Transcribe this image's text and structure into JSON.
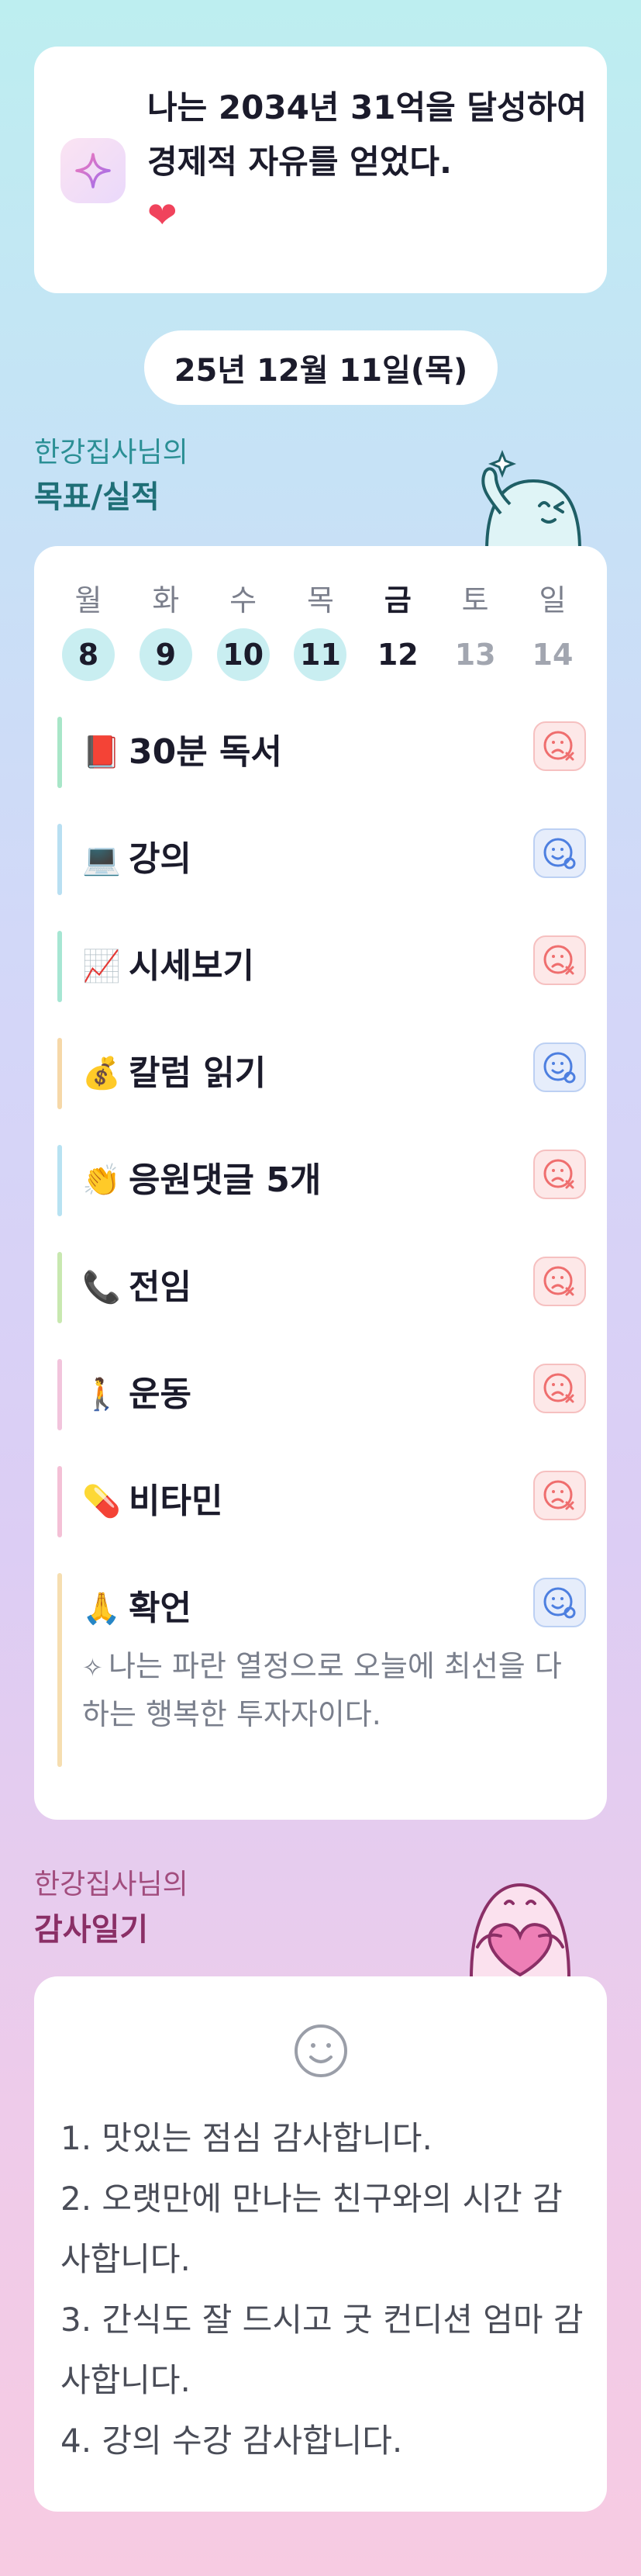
{
  "goal": {
    "text": "나는 2034년 31억을 달성하여 경제적 자유를 얻었다.",
    "heart": "❤"
  },
  "date_label": "25년 12월 11일(목)",
  "tracker_section": {
    "subtitle": "한강집사님의",
    "title": "목표/실적"
  },
  "week": [
    {
      "name": "월",
      "num": "8",
      "state": "done"
    },
    {
      "name": "화",
      "num": "9",
      "state": "done"
    },
    {
      "name": "수",
      "num": "10",
      "state": "done"
    },
    {
      "name": "목",
      "num": "11",
      "state": "done"
    },
    {
      "name": "금",
      "num": "12",
      "state": "cur"
    },
    {
      "name": "토",
      "num": "13",
      "state": "future"
    },
    {
      "name": "일",
      "num": "14",
      "state": "future"
    }
  ],
  "habits": [
    {
      "emoji": "📕",
      "label": "30분 독서",
      "status": "miss",
      "color": "#a8e6c8"
    },
    {
      "emoji": "💻",
      "label": "강의",
      "status": "done",
      "color": "#b8dff2"
    },
    {
      "emoji": "📈",
      "label": "시세보기",
      "status": "miss",
      "color": "#a6e6d3"
    },
    {
      "emoji": "💰",
      "label": "칼럼 읽기",
      "status": "done",
      "color": "#f6d8a8"
    },
    {
      "emoji": "👏",
      "label": "응원댓글 5개",
      "status": "miss",
      "color": "#b7e2f2"
    },
    {
      "emoji": "📞",
      "label": "전임",
      "status": "miss",
      "color": "#c8e8b0"
    },
    {
      "emoji": "🚶",
      "label": "운동",
      "status": "miss",
      "color": "#f2c4dc"
    },
    {
      "emoji": "💊",
      "label": "비타민",
      "status": "miss",
      "color": "#f4c0d6"
    },
    {
      "emoji": "🙏",
      "label": "확언",
      "status": "done",
      "color": "#f6deb0"
    }
  ],
  "affirmation": {
    "icon": "✧",
    "text": "나는 파란 열정으로 오늘에 최선을 다하는 행복한 투자자이다."
  },
  "gratitude_section": {
    "subtitle": "한강집사님의",
    "title": "감사일기"
  },
  "gratitude": [
    "1. 맛있는 점심 감사합니다.",
    "2. 오랫만에 만나는 친구와의 시간 감사합니다.",
    "3. 간식도 잘 드시고 굿 컨디션 엄마 감사합니다.",
    "4. 강의 수강 감사합니다."
  ],
  "colors": {
    "miss_icon": "#ef6e6e",
    "done_icon": "#4d7fe0",
    "accent_teal": "#1f6f77",
    "accent_pink": "#8a2f66"
  }
}
